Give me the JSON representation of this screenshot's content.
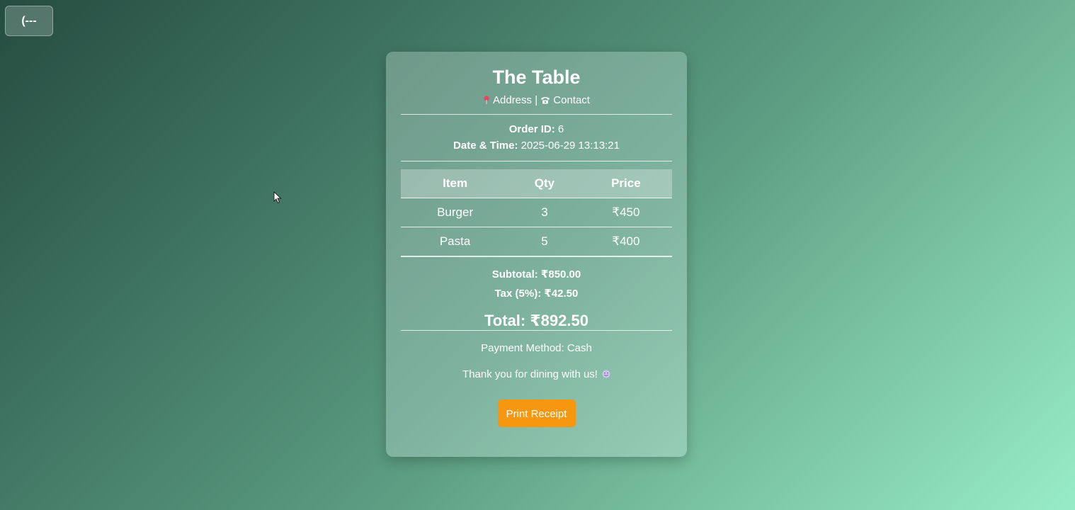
{
  "back_button": {
    "label": "(---",
    "icon": "back-arrow-icon"
  },
  "receipt": {
    "title": "The Table",
    "address_label": "Address",
    "separator": "|",
    "contact_label": "Contact",
    "order_id_label": "Order ID:",
    "order_id_value": "6",
    "datetime_label": "Date & Time:",
    "datetime_value": "2025-06-29 13:13:21",
    "table": {
      "headers": [
        "Item",
        "Qty",
        "Price"
      ],
      "rows": [
        [
          "Burger",
          "3",
          "₹450"
        ],
        [
          "Pasta",
          "5",
          "₹400"
        ]
      ]
    },
    "subtotal_label": "Subtotal:",
    "subtotal_value": "₹850.00",
    "tax_label": "Tax (5%):",
    "tax_value": "₹42.50",
    "total_label": "Total:",
    "total_value": "₹892.50",
    "payment_text": "Payment Method: Cash",
    "thanks_text": "Thank you for dining with us!",
    "print_label": "Print Receipt"
  },
  "colors": {
    "print_button": "#f7960f",
    "background_start": "#264c40",
    "background_end": "#97ecc6"
  },
  "icons": [
    "pin-icon",
    "phone-icon",
    "smile-icon",
    "mouse-cursor-icon"
  ]
}
